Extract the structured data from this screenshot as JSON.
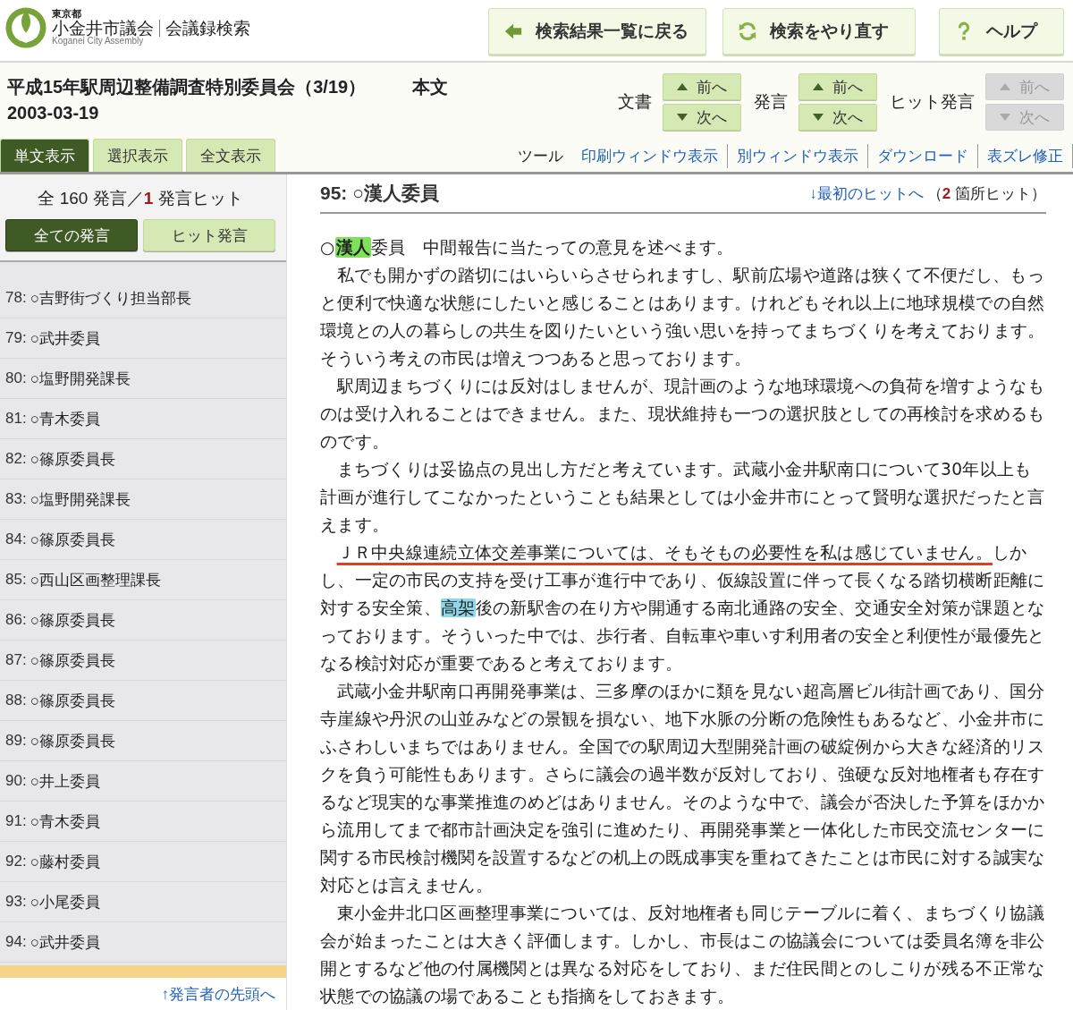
{
  "header": {
    "logo_top": "東京都",
    "logo_name": "小金井市議会",
    "logo_section": "会議録検索",
    "logo_en": "Koganei City Assembly",
    "buttons": [
      {
        "kind": "back",
        "label": "検索結果一覧に戻る"
      },
      {
        "kind": "retry",
        "label": "検索をやり直す"
      },
      {
        "kind": "help",
        "label": "ヘルプ"
      }
    ]
  },
  "document": {
    "title": "平成15年駅周辺整備調査特別委員会（3/19）",
    "section": "本文",
    "date": "2003-03-19"
  },
  "navigation": [
    {
      "label": "文書",
      "prev": "前へ",
      "next": "次へ",
      "disabled": false
    },
    {
      "label": "発言",
      "prev": "前へ",
      "next": "次へ",
      "disabled": false
    },
    {
      "label": "ヒット発言",
      "prev": "前へ",
      "next": "次へ",
      "disabled": true
    }
  ],
  "tabs": [
    {
      "label": "単文表示",
      "selected": true
    },
    {
      "label": "選択表示",
      "selected": false
    },
    {
      "label": "全文表示",
      "selected": false
    }
  ],
  "tools": {
    "label": "ツール",
    "links": [
      "印刷ウィンドウ表示",
      "別ウィンドウ表示",
      "ダウンロード",
      "表ズレ修正"
    ]
  },
  "sidebar": {
    "count_before": "全 160 発言／",
    "count_hits": "1",
    "count_after": " 発言ヒット",
    "filters": [
      {
        "label": "全ての発言",
        "selected": true
      },
      {
        "label": "ヒット発言",
        "selected": false
      }
    ],
    "items": [
      {
        "number": "78:",
        "speaker": "○吉野街づくり担当部長"
      },
      {
        "number": "79:",
        "speaker": "○武井委員"
      },
      {
        "number": "80:",
        "speaker": "○塩野開発課長"
      },
      {
        "number": "81:",
        "speaker": "○青木委員"
      },
      {
        "number": "82:",
        "speaker": "○篠原委員長"
      },
      {
        "number": "83:",
        "speaker": "○塩野開発課長"
      },
      {
        "number": "84:",
        "speaker": "○篠原委員長"
      },
      {
        "number": "85:",
        "speaker": "○西山区画整理課長"
      },
      {
        "number": "86:",
        "speaker": "○篠原委員長"
      },
      {
        "number": "87:",
        "speaker": "○篠原委員長"
      },
      {
        "number": "88:",
        "speaker": "○篠原委員長"
      },
      {
        "number": "89:",
        "speaker": "○篠原委員長"
      },
      {
        "number": "90:",
        "speaker": "○井上委員"
      },
      {
        "number": "91:",
        "speaker": "○青木委員"
      },
      {
        "number": "92:",
        "speaker": "○藤村委員"
      },
      {
        "number": "93:",
        "speaker": "○小尾委員"
      },
      {
        "number": "94:",
        "speaker": "○武井委員"
      }
    ],
    "top_link": "↑発言者の先頭へ"
  },
  "speech": {
    "heading": "95: ○漢人委員",
    "first_hit_link": "↓最初のヒットへ",
    "hits_before": "（",
    "hits_count": "2",
    "hits_after": " 箇所ヒット）",
    "paragraphs": [
      {
        "indent": false,
        "segments": [
          {
            "kind": "plain",
            "text": "○"
          },
          {
            "kind": "name_hit",
            "text": "漢人"
          },
          {
            "kind": "plain",
            "text": "委員　中間報告に当たっての意見を述べます。"
          }
        ]
      },
      {
        "indent": true,
        "segments": [
          {
            "kind": "plain",
            "text": "私でも開かずの踏切にはいらいらさせられますし、駅前広場や道路は狭くて不便だし、もっと便利で快適な状態にしたいと感じることはあります。けれどもそれ以上に地球規模での自然環境との人の暮らしの共生を図りたいという強い思いを持ってまちづくりを考えております。そういう考えの市民は増えつつあると思っております。"
          }
        ]
      },
      {
        "indent": true,
        "segments": [
          {
            "kind": "plain",
            "text": "駅周辺まちづくりには反対はしませんが、現計画のような地球環境への負荷を増すようなものは受け入れることはできません。また、現状維持も一つの選択肢としての再検討を求めるものです。"
          }
        ]
      },
      {
        "indent": true,
        "segments": [
          {
            "kind": "plain",
            "text": "まちづくりは妥協点の見出し方だと考えています。武蔵小金井駅南口について30年以上も計画が進行してこなかったということも結果としては小金井市にとって賢明な選択だったと言えます。"
          }
        ]
      },
      {
        "indent": true,
        "segments": [
          {
            "kind": "underline",
            "text": "ＪＲ中央線連続立体交差事業については、そもそもの必要性を私は感じていません。"
          },
          {
            "kind": "plain",
            "text": "しかし、一定の市民の支持を受け工事が進行中であり、仮線設置に伴って長くなる踏切横断距離に対する安全策、"
          },
          {
            "kind": "keyword_hit",
            "text": "高架"
          },
          {
            "kind": "plain",
            "text": "後の新駅舎の在り方や開通する南北通路の安全、交通安全対策が課題となっております。そういった中では、歩行者、自転車や車いす利用者の安全と利便性が最優先となる検討対応が重要であると考えております。"
          }
        ]
      },
      {
        "indent": true,
        "segments": [
          {
            "kind": "plain",
            "text": "武蔵小金井駅南口再開発事業は、三多摩のほかに類を見ない超高層ビル街計画であり、国分寺崖線や丹沢の山並みなどの景観を損ない、地下水脈の分断の危険性もあるなど、小金井市にふさわしいまちではありません。全国での駅周辺大型開発計画の破綻例から大きな経済的リスクを負う可能性もあります。さらに議会の過半数が反対しており、強硬な反対地権者も存在するなど現実的な事業推進のめどはありません。そのような中で、議会が否決した予算をほかから流用してまで都市計画決定を強引に進めたり、再開発事業と一体化した市民交流センターに関する市民検討機関を設置するなどの机上の既成事実を重ねてきたことは市民に対する誠実な対応とは言えません。"
          }
        ]
      },
      {
        "indent": true,
        "segments": [
          {
            "kind": "plain",
            "text": "東小金井北口区画整理事業については、反対地権者も同じテーブルに着く、まちづくり協議会が始まったことは大きく評価します。しかし、市長はこの協議会については委員名簿を非公開とするなど他の付属機関とは異なる対応をしており、まだ住民間とのしこりが残る不正常な状態での協議の場であることも指摘をしておきます。"
          }
        ]
      }
    ]
  }
}
